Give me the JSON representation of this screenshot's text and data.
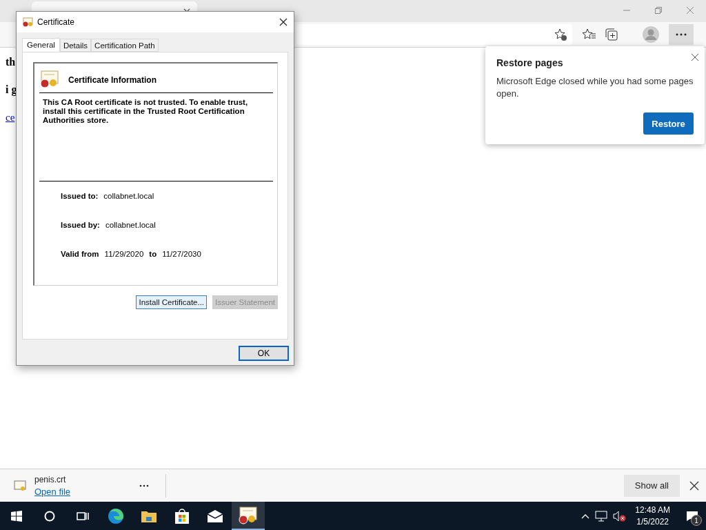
{
  "page": {
    "texts": [
      {
        "kind": "heading",
        "text": "th"
      },
      {
        "kind": "heading",
        "text": "i g"
      },
      {
        "kind": "link",
        "text": "ce"
      }
    ]
  },
  "restore_popup": {
    "title": "Restore pages",
    "message": "Microsoft Edge closed while you had some pages open.",
    "button": "Restore"
  },
  "download_bar": {
    "file_name": "penis.crt",
    "action": "Open file",
    "show_all": "Show all"
  },
  "dialog": {
    "title": "Certificate",
    "tabs": [
      {
        "label": "General",
        "selected": true
      },
      {
        "label": "Details",
        "selected": false
      },
      {
        "label": "Certification Path",
        "selected": false
      }
    ],
    "heading": "Certificate Information",
    "message": "This CA Root certificate is not trusted. To enable trust, install this certificate in the Trusted Root Certification Authorities store.",
    "fields": [
      {
        "label": "Issued to:",
        "value": "collabnet.local"
      },
      {
        "label": "Issued by:",
        "value": "collabnet.local"
      }
    ],
    "validity": {
      "label": "Valid from",
      "from": "11/29/2020",
      "to_label": "to",
      "to": "11/27/2030"
    },
    "buttons": [
      {
        "label": "Install Certificate...",
        "disabled": false
      },
      {
        "label": "Issuer Statement",
        "disabled": true
      }
    ],
    "ok": "OK"
  },
  "taskbar": {
    "time": "12:48 AM",
    "date": "1/5/2022",
    "notifications": "1"
  }
}
